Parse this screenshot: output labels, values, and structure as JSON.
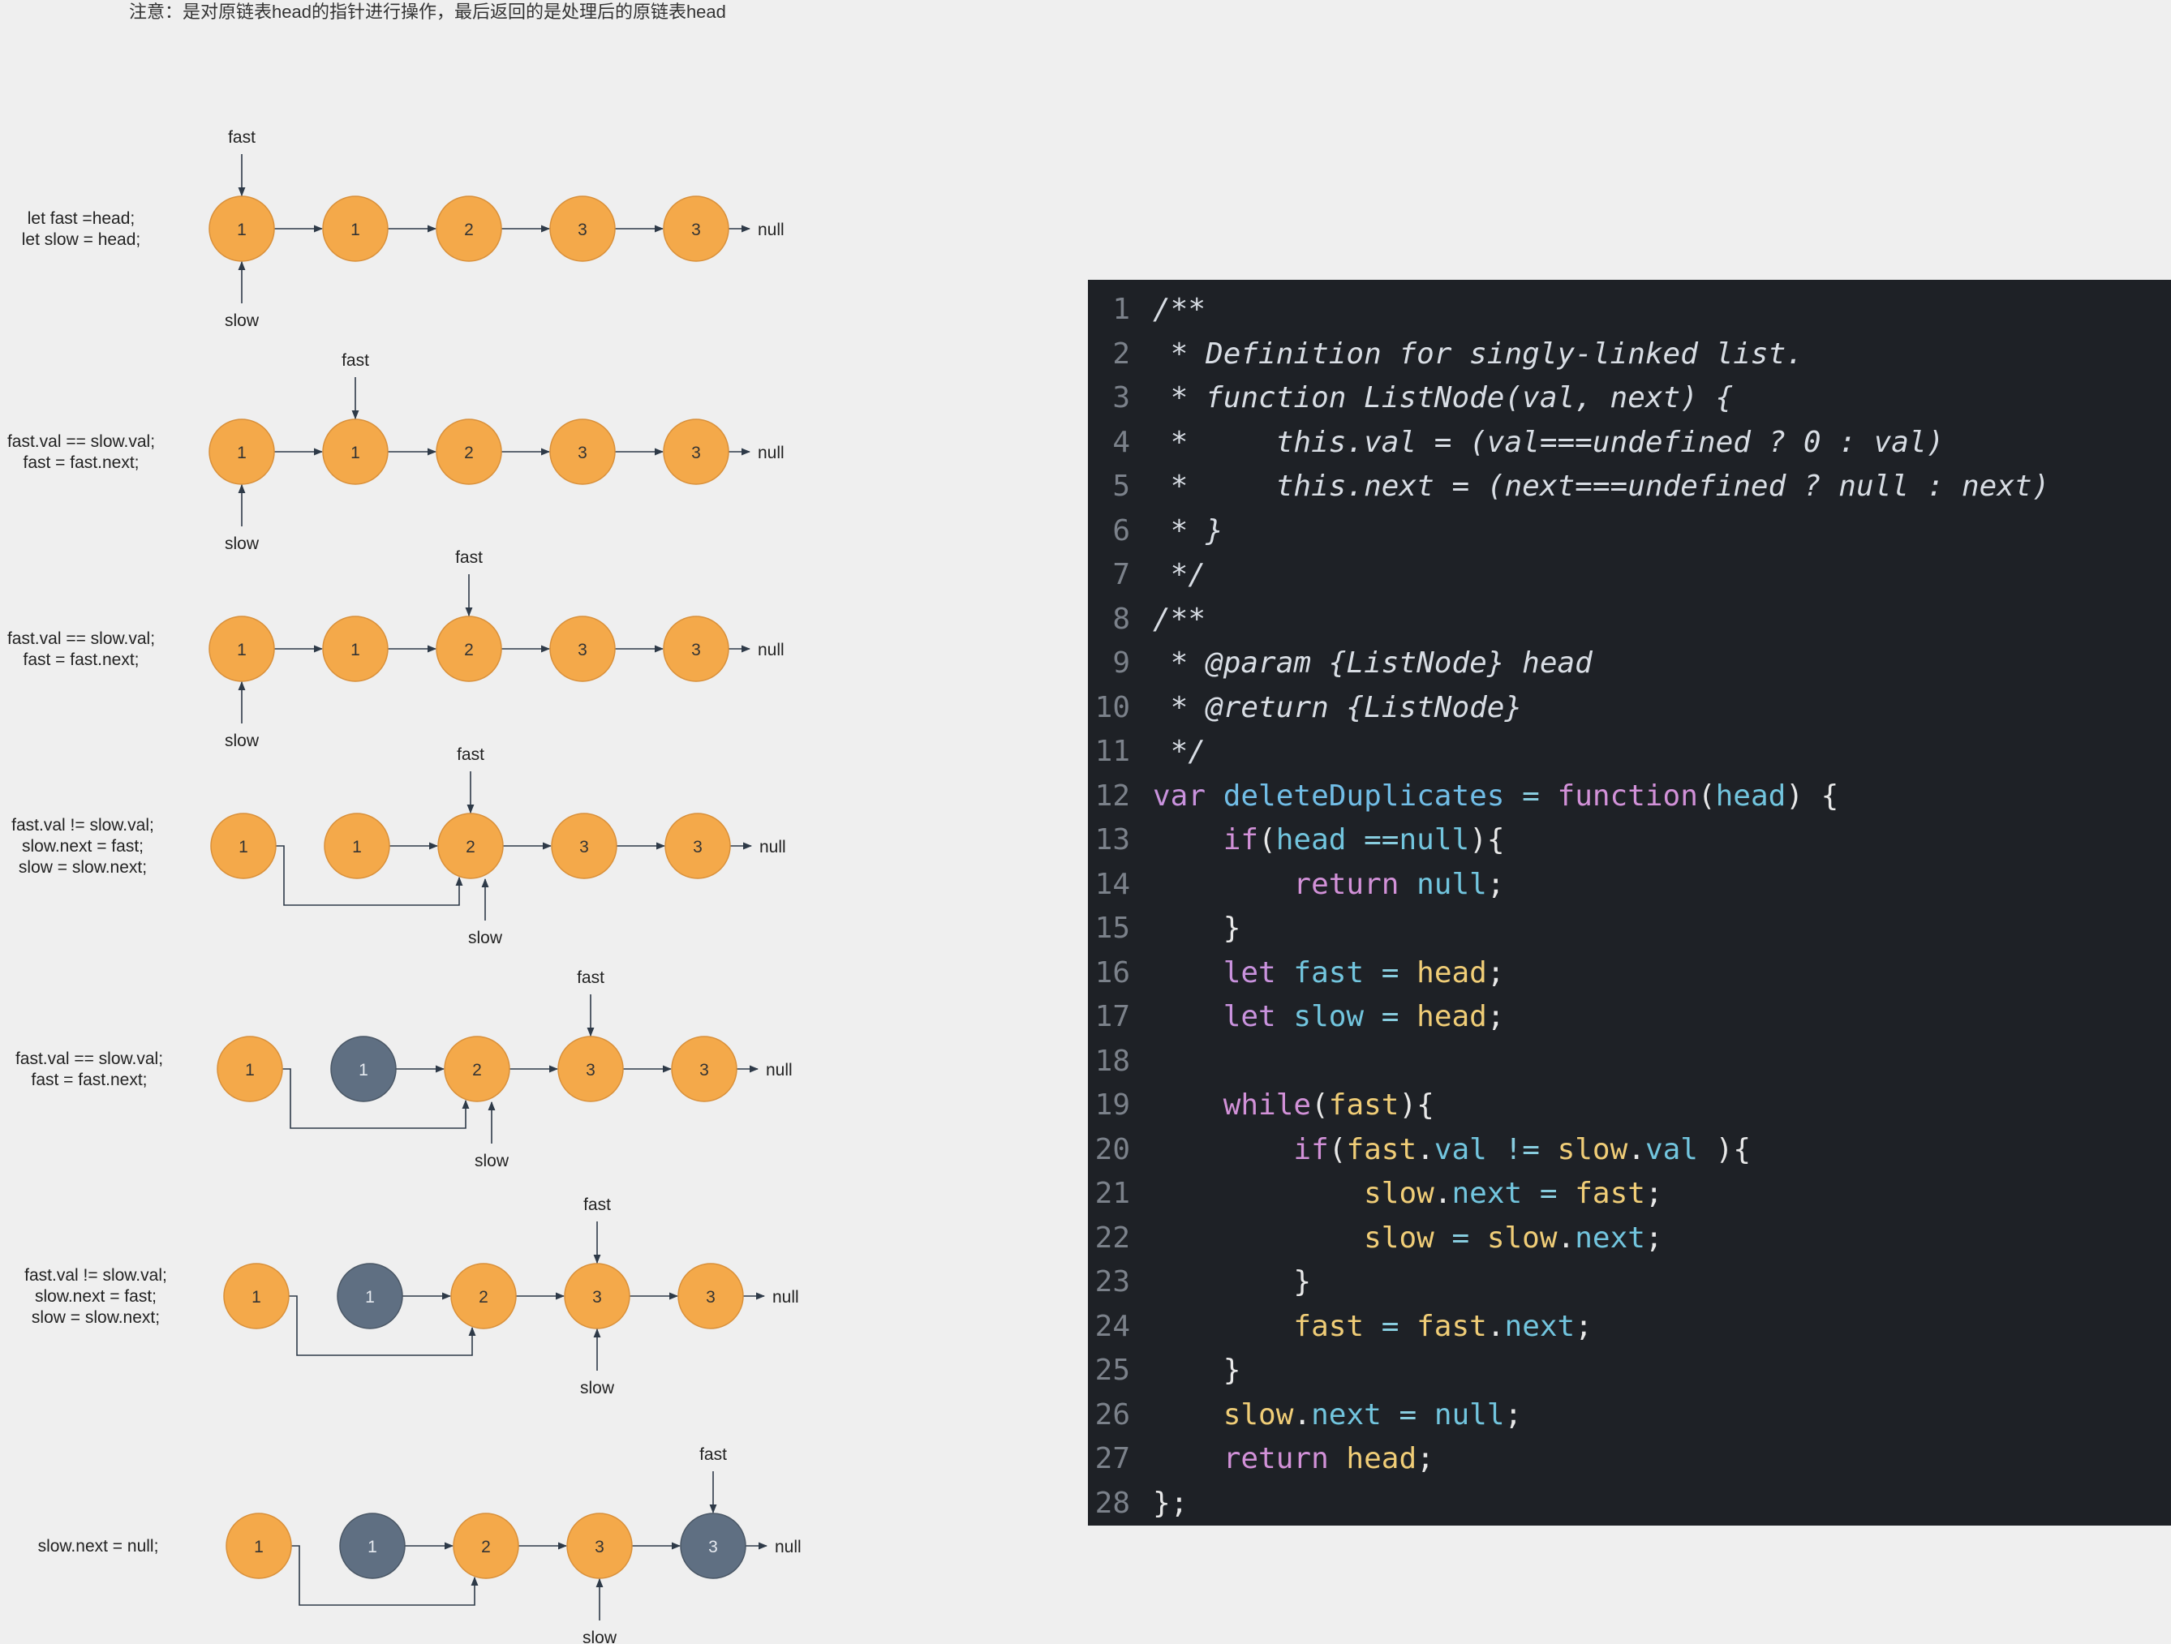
{
  "note": "注意：是对原链表head的指针进行操作，最后返回的是处理后的原链表head",
  "colors": {
    "node_active": "#f4a94a",
    "node_removed": "#5f6f82",
    "arrow": "#2e3a48",
    "code_bg": "#1e2126"
  },
  "pointer_labels": {
    "fast": "fast",
    "slow": "slow",
    "null": "null"
  },
  "steps": [
    {
      "caption": [
        "let fast =head;",
        "let slow = head;"
      ],
      "nodes": [
        {
          "value": "1",
          "state": "active"
        },
        {
          "value": "1",
          "state": "active"
        },
        {
          "value": "2",
          "state": "active"
        },
        {
          "value": "3",
          "state": "active"
        },
        {
          "value": "3",
          "state": "active"
        }
      ],
      "fast_node": 0,
      "slow_node": 0,
      "bypass": false
    },
    {
      "caption": [
        "fast.val == slow.val;",
        "fast = fast.next;"
      ],
      "nodes": [
        {
          "value": "1",
          "state": "active"
        },
        {
          "value": "1",
          "state": "active"
        },
        {
          "value": "2",
          "state": "active"
        },
        {
          "value": "3",
          "state": "active"
        },
        {
          "value": "3",
          "state": "active"
        }
      ],
      "fast_node": 1,
      "slow_node": 0,
      "bypass": false
    },
    {
      "caption": [
        "fast.val == slow.val;",
        "fast = fast.next;"
      ],
      "nodes": [
        {
          "value": "1",
          "state": "active"
        },
        {
          "value": "1",
          "state": "active"
        },
        {
          "value": "2",
          "state": "active"
        },
        {
          "value": "3",
          "state": "active"
        },
        {
          "value": "3",
          "state": "active"
        }
      ],
      "fast_node": 2,
      "slow_node": 0,
      "bypass": false
    },
    {
      "caption": [
        "fast.val != slow.val;",
        "slow.next = fast;",
        "slow = slow.next;"
      ],
      "nodes": [
        {
          "value": "1",
          "state": "active"
        },
        {
          "value": "1",
          "state": "active"
        },
        {
          "value": "2",
          "state": "active"
        },
        {
          "value": "3",
          "state": "active"
        },
        {
          "value": "3",
          "state": "active"
        }
      ],
      "fast_node": 2,
      "slow_node": 2,
      "bypass": true
    },
    {
      "caption": [
        "fast.val == slow.val;",
        "fast = fast.next;"
      ],
      "nodes": [
        {
          "value": "1",
          "state": "active"
        },
        {
          "value": "1",
          "state": "removed"
        },
        {
          "value": "2",
          "state": "active"
        },
        {
          "value": "3",
          "state": "active"
        },
        {
          "value": "3",
          "state": "active"
        }
      ],
      "fast_node": 3,
      "slow_node": 2,
      "bypass": true
    },
    {
      "caption": [
        "fast.val != slow.val;",
        "slow.next = fast;",
        "slow = slow.next;"
      ],
      "nodes": [
        {
          "value": "1",
          "state": "active"
        },
        {
          "value": "1",
          "state": "removed"
        },
        {
          "value": "2",
          "state": "active"
        },
        {
          "value": "3",
          "state": "active"
        },
        {
          "value": "3",
          "state": "active"
        }
      ],
      "fast_node": 3,
      "slow_node": 3,
      "bypass": true
    },
    {
      "caption": [
        "slow.next = null;"
      ],
      "nodes": [
        {
          "value": "1",
          "state": "active"
        },
        {
          "value": "1",
          "state": "removed"
        },
        {
          "value": "2",
          "state": "active"
        },
        {
          "value": "3",
          "state": "active"
        },
        {
          "value": "3",
          "state": "removed"
        }
      ],
      "fast_node": 4,
      "slow_node": 3,
      "bypass": true
    }
  ],
  "code": {
    "lines": [
      [
        [
          "cm",
          "/**"
        ]
      ],
      [
        [
          "cm",
          " * Definition for singly-linked list."
        ]
      ],
      [
        [
          "cm",
          " * function ListNode(val, next) {"
        ]
      ],
      [
        [
          "cm",
          " *     this.val = (val===undefined ? 0 : val)"
        ]
      ],
      [
        [
          "cm",
          " *     this.next = (next===undefined ? null : next)"
        ]
      ],
      [
        [
          "cm",
          " * }"
        ]
      ],
      [
        [
          "cm",
          " */"
        ]
      ],
      [
        [
          "cm",
          "/**"
        ]
      ],
      [
        [
          "cm",
          " * @param {ListNode} head"
        ]
      ],
      [
        [
          "cm",
          " * @return {ListNode}"
        ]
      ],
      [
        [
          "cm",
          " */"
        ]
      ],
      [
        [
          "kw",
          "var "
        ],
        [
          "fn",
          "deleteDuplicates"
        ],
        [
          "op",
          " = "
        ],
        [
          "fk",
          "function"
        ],
        [
          "pn",
          "("
        ],
        [
          "id",
          "head"
        ],
        [
          "pn",
          ") {"
        ]
      ],
      [
        [
          "pn",
          "    "
        ],
        [
          "fk",
          "if"
        ],
        [
          "pn",
          "("
        ],
        [
          "id",
          "head "
        ],
        [
          "op",
          "=="
        ],
        [
          "id",
          "null"
        ],
        [
          "pn",
          "){"
        ]
      ],
      [
        [
          "pn",
          "        "
        ],
        [
          "fk",
          "return "
        ],
        [
          "id",
          "null"
        ],
        [
          "pn",
          ";"
        ]
      ],
      [
        [
          "pn",
          "    }"
        ]
      ],
      [
        [
          "pn",
          "    "
        ],
        [
          "kw",
          "let "
        ],
        [
          "id",
          "fast"
        ],
        [
          "op",
          " = "
        ],
        [
          "pr",
          "head"
        ],
        [
          "pn",
          ";"
        ]
      ],
      [
        [
          "pn",
          "    "
        ],
        [
          "kw",
          "let "
        ],
        [
          "id",
          "slow"
        ],
        [
          "op",
          " = "
        ],
        [
          "pr",
          "head"
        ],
        [
          "pn",
          ";"
        ]
      ],
      [
        [
          "pn",
          ""
        ]
      ],
      [
        [
          "pn",
          "    "
        ],
        [
          "fk",
          "while"
        ],
        [
          "pn",
          "("
        ],
        [
          "pr",
          "fast"
        ],
        [
          "pn",
          "){"
        ]
      ],
      [
        [
          "pn",
          "        "
        ],
        [
          "fk",
          "if"
        ],
        [
          "pn",
          "("
        ],
        [
          "pr",
          "fast"
        ],
        [
          "pn",
          "."
        ],
        [
          "id",
          "val"
        ],
        [
          "op",
          " != "
        ],
        [
          "pr",
          "slow"
        ],
        [
          "pn",
          "."
        ],
        [
          "id",
          "val"
        ],
        [
          "pn",
          " ){"
        ]
      ],
      [
        [
          "pn",
          "            "
        ],
        [
          "pr",
          "slow"
        ],
        [
          "pn",
          "."
        ],
        [
          "id",
          "next"
        ],
        [
          "op",
          " = "
        ],
        [
          "pr",
          "fast"
        ],
        [
          "pn",
          ";"
        ]
      ],
      [
        [
          "pn",
          "            "
        ],
        [
          "pr",
          "slow"
        ],
        [
          "op",
          " = "
        ],
        [
          "pr",
          "slow"
        ],
        [
          "pn",
          "."
        ],
        [
          "id",
          "next"
        ],
        [
          "pn",
          ";"
        ]
      ],
      [
        [
          "pn",
          "        }"
        ]
      ],
      [
        [
          "pn",
          "        "
        ],
        [
          "pr",
          "fast"
        ],
        [
          "op",
          " = "
        ],
        [
          "pr",
          "fast"
        ],
        [
          "pn",
          "."
        ],
        [
          "id",
          "next"
        ],
        [
          "pn",
          ";"
        ]
      ],
      [
        [
          "pn",
          "    }"
        ]
      ],
      [
        [
          "pn",
          "    "
        ],
        [
          "pr",
          "slow"
        ],
        [
          "pn",
          "."
        ],
        [
          "id",
          "next"
        ],
        [
          "op",
          " = "
        ],
        [
          "id",
          "null"
        ],
        [
          "pn",
          ";"
        ]
      ],
      [
        [
          "pn",
          "    "
        ],
        [
          "fk",
          "return "
        ],
        [
          "pr",
          "head"
        ],
        [
          "pn",
          ";"
        ]
      ],
      [
        [
          "pn",
          "};"
        ]
      ]
    ]
  }
}
